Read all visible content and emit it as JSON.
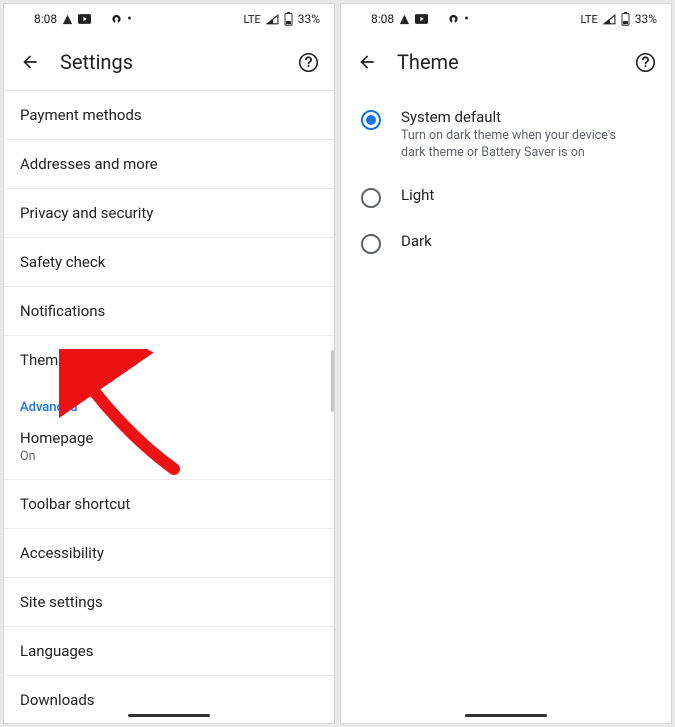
{
  "statusbar": {
    "time": "8:08",
    "network_label": "LTE",
    "battery_percent": "33%"
  },
  "screen1": {
    "title": "Settings",
    "rows": [
      {
        "label": "Payment methods"
      },
      {
        "label": "Addresses and more"
      },
      {
        "label": "Privacy and security"
      },
      {
        "label": "Safety check"
      },
      {
        "label": "Notifications"
      },
      {
        "label": "Theme"
      }
    ],
    "advanced_header": "Advanced",
    "advanced_rows": {
      "homepage_label": "Homepage",
      "homepage_value": "On",
      "toolbar_shortcut": "Toolbar shortcut",
      "accessibility": "Accessibility",
      "site_settings": "Site settings",
      "languages": "Languages",
      "downloads": "Downloads"
    }
  },
  "screen2": {
    "title": "Theme",
    "options": [
      {
        "label": "System default",
        "desc": "Turn on dark theme when your device's dark theme or Battery Saver is on",
        "selected": true
      },
      {
        "label": "Light",
        "desc": "",
        "selected": false
      },
      {
        "label": "Dark",
        "desc": "",
        "selected": false
      }
    ]
  }
}
